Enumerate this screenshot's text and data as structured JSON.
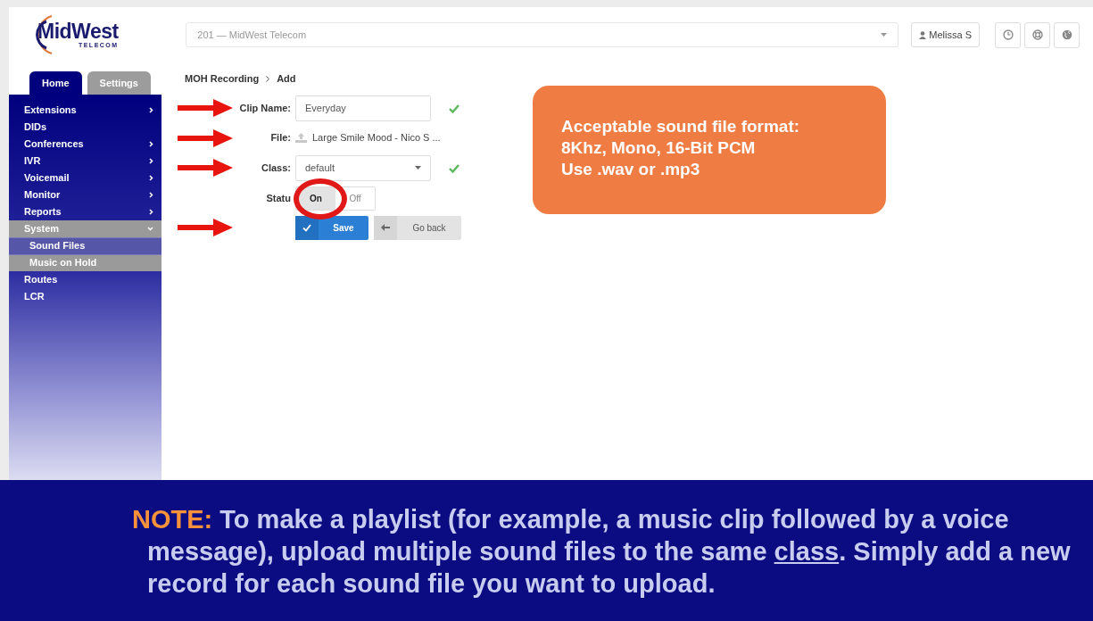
{
  "logo": {
    "name": "MidWest",
    "tagline": "TELECOM"
  },
  "account_select": {
    "value": "201  —  MidWest Telecom"
  },
  "user_button": {
    "label": "Melissa S"
  },
  "toolbar_icons": [
    {
      "kind": "clock"
    },
    {
      "kind": "lifebuoy"
    },
    {
      "kind": "globe"
    }
  ],
  "tabs": [
    {
      "label": "Home",
      "selected": true
    },
    {
      "label": "Settings",
      "selected": false
    }
  ],
  "sidebar": {
    "items": [
      {
        "label": "Extensions",
        "has_submenu": true,
        "expanded": false,
        "selected": false
      },
      {
        "label": "DIDs",
        "has_submenu": false,
        "selected": false
      },
      {
        "label": "Conferences",
        "has_submenu": true,
        "expanded": false,
        "selected": false
      },
      {
        "label": "IVR",
        "has_submenu": true,
        "expanded": false,
        "selected": false
      },
      {
        "label": "Voicemail",
        "has_submenu": true,
        "expanded": false,
        "selected": false
      },
      {
        "label": "Monitor",
        "has_submenu": true,
        "expanded": false,
        "selected": false
      },
      {
        "label": "Reports",
        "has_submenu": true,
        "expanded": false,
        "selected": false
      },
      {
        "label": "System",
        "has_submenu": true,
        "expanded": true,
        "selected": true,
        "children": [
          {
            "label": "Sound Files",
            "selected": false
          },
          {
            "label": "Music on Hold",
            "selected": true
          }
        ]
      },
      {
        "label": "Routes",
        "has_submenu": false,
        "selected": false
      },
      {
        "label": "LCR",
        "has_submenu": false,
        "selected": false
      }
    ]
  },
  "breadcrumb": [
    "MOH Recording",
    "Add"
  ],
  "form": {
    "rows": [
      {
        "kind": "input",
        "label": "Clip Name:",
        "value": "Everyday",
        "valid": true,
        "arrow": true
      },
      {
        "kind": "file",
        "label": "File:",
        "value": "Large Smile Mood - Nico S ...",
        "arrow": true
      },
      {
        "kind": "select",
        "label": "Class:",
        "value": "default",
        "valid": true,
        "arrow": true
      },
      {
        "kind": "toggle",
        "label": "Statu",
        "arrow": false,
        "options": [
          {
            "label": "On",
            "selected": true,
            "circled": true
          },
          {
            "label": "Off",
            "selected": false,
            "circled": false
          }
        ]
      },
      {
        "kind": "buttons",
        "arrow": true,
        "buttons": [
          {
            "kind": "save",
            "label": "Save"
          },
          {
            "kind": "back",
            "label": "Go back"
          }
        ]
      }
    ]
  },
  "callout": {
    "lines": [
      "Acceptable sound file format:",
      "8Khz, Mono, 16-Bit PCM",
      "Use .wav or .mp3"
    ]
  },
  "note": {
    "label": "NOTE:",
    "text_before": "To make a playlist (for example, a music clip followed by a voice message), upload multiple sound files to the same ",
    "underlined": "class",
    "text_after": ". Simply add a new record for each sound file you want to upload."
  }
}
